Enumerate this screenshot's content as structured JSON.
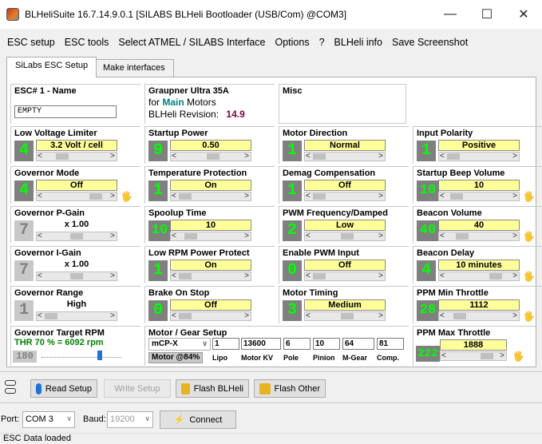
{
  "window": {
    "title": "BLHeliSuite 16.7.14.9.0.1  [SILABS BLHeli Bootloader (USB/Com) @COM3]",
    "min": "—",
    "max": "☐",
    "close": "✕"
  },
  "menu": [
    "ESC setup",
    "ESC tools",
    "Select ATMEL / SILABS Interface",
    "Options",
    "?",
    "BLHeli info",
    "Save Screenshot"
  ],
  "tabs": {
    "active": "SiLabs ESC Setup",
    "other": "Make interfaces"
  },
  "esc": {
    "title": "ESC# 1 - Name",
    "name": "EMPTY"
  },
  "info": {
    "line1": "Graupner Ultra 35A",
    "line2_pre": "for",
    "line2_main": "Main",
    "line2_post": "Motors",
    "rev_label": "BLHeli Revision:",
    "rev_value": "14.9"
  },
  "misc": {
    "title": "Misc"
  },
  "params": [
    {
      "title": "Low Voltage Limiter",
      "value": "3.2 Volt / cell",
      "num": "4",
      "level": 0.2
    },
    {
      "title": "Startup Power",
      "value": "0.50",
      "num": "9",
      "level": 0.5
    },
    {
      "title": "Motor Direction",
      "value": "Normal",
      "num": "1",
      "level": 0.0
    },
    {
      "title": "Input Polarity",
      "value": "Positive",
      "num": "1",
      "level": 0.0
    },
    {
      "title": "Governor Mode",
      "value": "Off",
      "num": "4",
      "level": 0.8
    },
    {
      "title": "Temperature Protection",
      "value": "On",
      "num": "1",
      "level": 0.0
    },
    {
      "title": "Demag Compensation",
      "value": "Off",
      "num": "1",
      "level": 0.0
    },
    {
      "title": "Startup Beep Volume",
      "value": "10",
      "num": "10",
      "level": 0.05
    },
    {
      "title": "Governor P-Gain",
      "value": "x 1.00",
      "num": "7",
      "level": 0.45
    },
    {
      "title": "Spoolup Time",
      "value": "10",
      "num": "10",
      "level": 0.1
    },
    {
      "title": "PWM Frequency/Damped",
      "value": "Low",
      "num": "2",
      "level": 0.5
    },
    {
      "title": "Beacon Volume",
      "value": "40",
      "num": "40",
      "level": 0.15
    },
    {
      "title": "Governor I-Gain",
      "value": "x 1.00",
      "num": "7",
      "level": 0.45
    },
    {
      "title": "Low RPM Power Protect",
      "value": "On",
      "num": "1",
      "level": 0.0
    },
    {
      "title": "Enable PWM Input",
      "value": "Off",
      "num": "0",
      "level": 0.0
    },
    {
      "title": "Beacon Delay",
      "value": "10 minutes",
      "num": "4",
      "level": 0.75
    },
    {
      "title": "Governor Range",
      "value": "High",
      "num": "1",
      "level": 0.0
    },
    {
      "title": "Brake On Stop",
      "value": "Off",
      "num": "0",
      "level": 0.0
    },
    {
      "title": "Motor Timing",
      "value": "Medium",
      "num": "3",
      "level": 0.5
    },
    {
      "title": "PPM Min Throttle",
      "value": "1112",
      "num": "28",
      "level": 0.12
    }
  ],
  "target_rpm": {
    "title": "Governor Target RPM",
    "value": "THR 70 % = 6092 rpm",
    "num": "180",
    "level": 0.7
  },
  "motor_gear": {
    "title": "Motor / Gear Setup",
    "model": "mCP-X",
    "lipo": "1",
    "kv": "13600",
    "pole": "6",
    "pinion": "10",
    "mgear": "64",
    "comp": "81",
    "motor_pct": "Motor @84%",
    "lbl_lipo": "Lipo",
    "lbl_kv": "Motor KV",
    "lbl_pole": "Pole",
    "lbl_pinion": "Pinion",
    "lbl_mgear": "M-Gear",
    "lbl_comp": "Comp."
  },
  "ppm_max": {
    "title": "PPM Max Throttle",
    "value": "1888",
    "num": "222",
    "level": 0.8
  },
  "buttons": {
    "read": "Read Setup",
    "write": "Write Setup",
    "flash_blheli": "Flash BLHeli",
    "flash_other": "Flash Other"
  },
  "port": {
    "label": "Port:",
    "value": "COM 3",
    "baud_label": "Baud:",
    "baud_value": "19200",
    "connect": "Connect"
  },
  "status": "ESC Data loaded"
}
